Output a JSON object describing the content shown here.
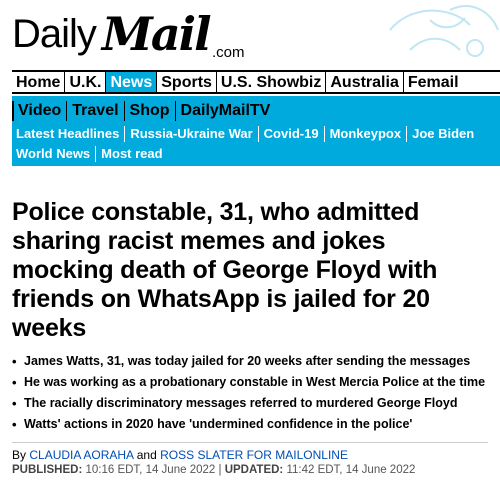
{
  "header": {
    "logo_daily": "Daily",
    "logo_mail": "Mail",
    "logo_com": ".com"
  },
  "nav_primary": {
    "items": [
      "Home",
      "U.K.",
      "News",
      "Sports",
      "U.S. Showbiz",
      "Australia",
      "Femail"
    ],
    "active": "News",
    "active_color": "#00aadd"
  },
  "nav_secondary": {
    "row1": [
      "Video",
      "Travel",
      "Shop",
      "DailyMailTV"
    ],
    "row2": [
      "Latest Headlines",
      "Russia-Ukraine War",
      "Covid-19",
      "Monkeypox",
      "Joe Biden"
    ],
    "row3": [
      "World News",
      "Most read"
    ]
  },
  "article": {
    "headline": "Police constable, 31, who admitted sharing racist memes and jokes mocking death of George Floyd with friends on WhatsApp is jailed for 20 weeks",
    "bullets": [
      "James Watts, 31, was today jailed for 20 weeks after sending the messages",
      "He was working as a probationary constable in West Mercia Police at the time",
      "The racially discriminatory messages referred to murdered George Floyd",
      "Watts' actions in 2020 have 'undermined confidence in the police'"
    ],
    "byline_prefix": "By",
    "author1": "CLAUDIA AORAHA",
    "byline_and": "and",
    "author2": "ROSS SLATER FOR MAILONLINE",
    "published_label": "PUBLISHED:",
    "published_value": "10:16 EDT, 14 June 2022",
    "separator": "|",
    "updated_label": "UPDATED:",
    "updated_value": "11:42 EDT, 14 June 2022"
  }
}
